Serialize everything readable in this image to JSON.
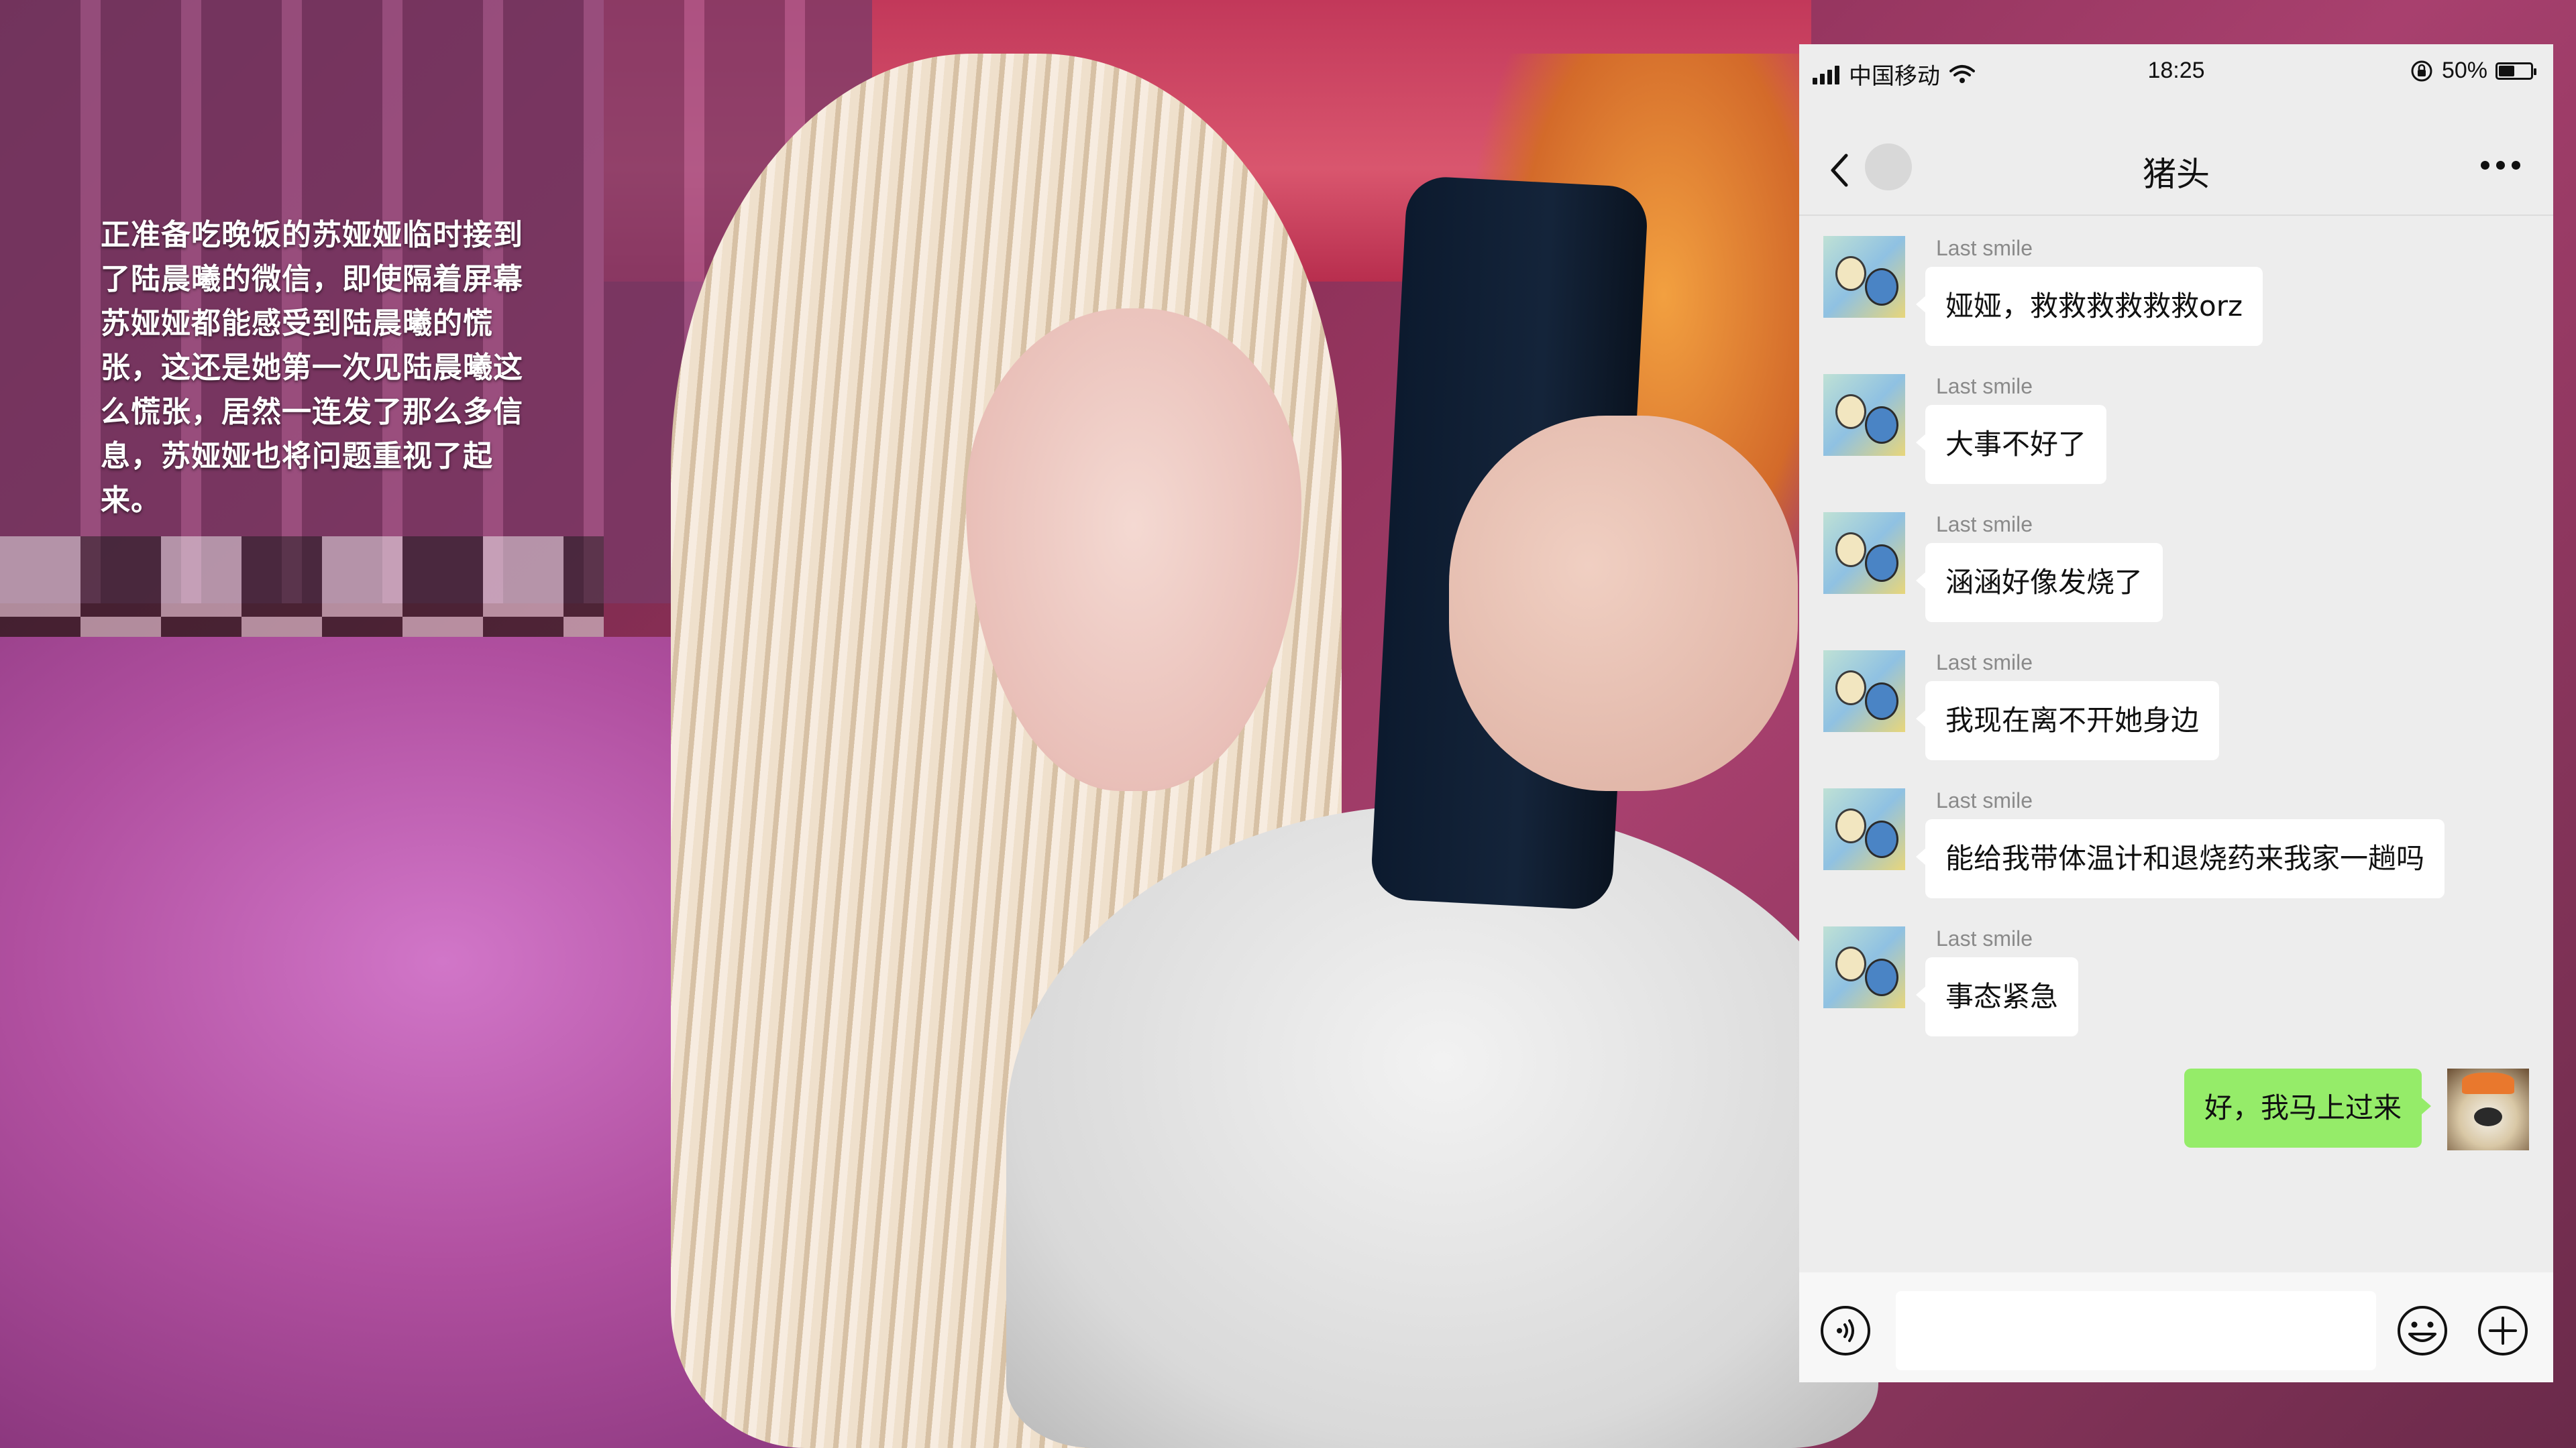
{
  "caption": {
    "text": "正准备吃晚饭的苏娅娅临时接到了陆晨曦的微信，即使隔着屏幕苏娅娅都能感受到陆晨曦的慌张，这还是她第一次见陆晨曦这么慌张，居然一连发了那么多信息，苏娅娅也将问题重视了起来。"
  },
  "status_bar": {
    "carrier": "中国移动",
    "time": "18:25",
    "battery": "50%",
    "battery_level": 0.5
  },
  "chat": {
    "title": "猪头",
    "messages": [
      {
        "sender": "Last smile",
        "text": "娅娅，救救救救救救orz",
        "direction": "in"
      },
      {
        "sender": "Last smile",
        "text": "大事不好了",
        "direction": "in"
      },
      {
        "sender": "Last smile",
        "text": "涵涵好像发烧了",
        "direction": "in"
      },
      {
        "sender": "Last smile",
        "text": "我现在离不开她身边",
        "direction": "in"
      },
      {
        "sender": "Last smile",
        "text": "能给我带体温计和退烧药来我家一趟吗",
        "direction": "in"
      },
      {
        "sender": "Last smile",
        "text": "事态紧急",
        "direction": "in"
      },
      {
        "sender": "",
        "text": "好，我马上过来",
        "direction": "out"
      }
    ]
  },
  "input": {
    "placeholder": "",
    "value": ""
  },
  "colors": {
    "chat_bg": "#ededed",
    "out_bubble": "#95ec69",
    "in_bubble": "#ffffff"
  },
  "icons": {
    "back": "chevron-left-icon",
    "more": "ellipsis-icon",
    "voice": "voice-icon",
    "emoji": "emoji-icon",
    "plus": "plus-circle-icon"
  }
}
